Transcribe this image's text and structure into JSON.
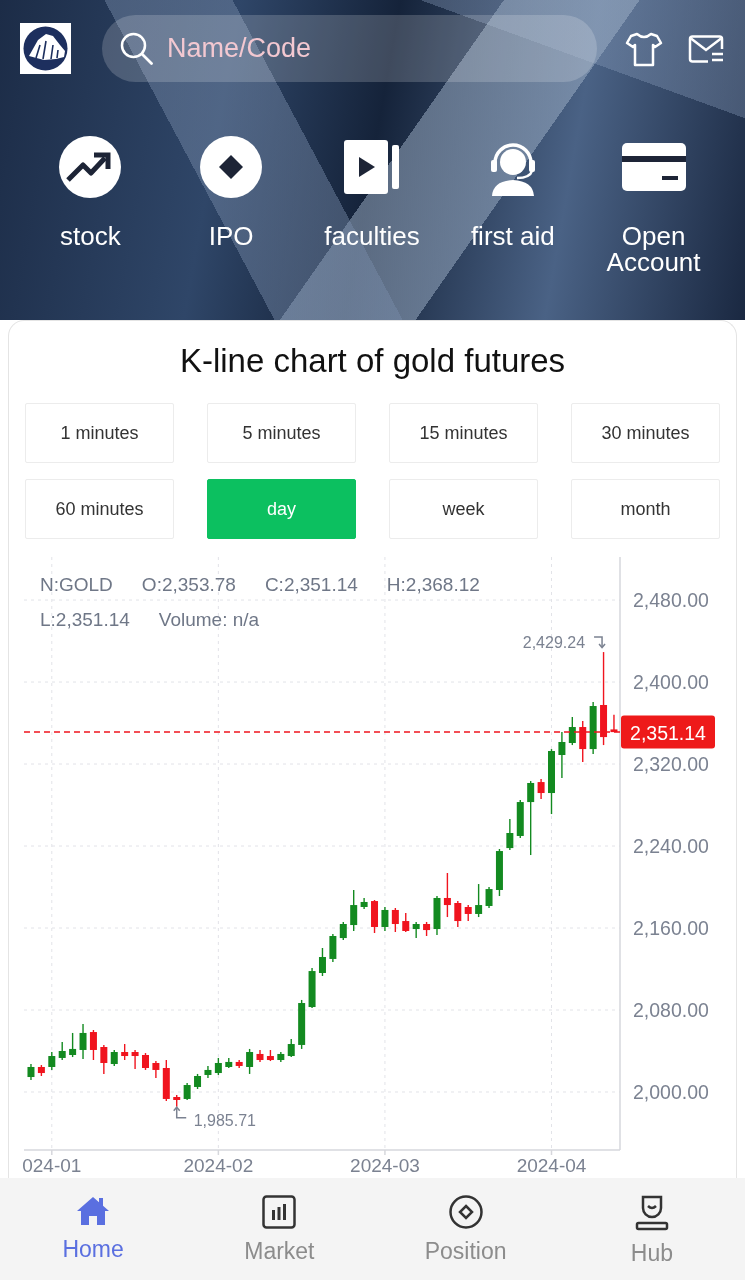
{
  "header": {
    "search": {
      "placeholder": "Name/Code"
    }
  },
  "shortcuts": [
    {
      "label": "stock"
    },
    {
      "label": "IPO"
    },
    {
      "label": "faculties"
    },
    {
      "label": "first aid"
    },
    {
      "label": "Open Account"
    }
  ],
  "chart_card": {
    "title": "K-line chart of gold futures",
    "periods": [
      {
        "label": "1 minutes",
        "selected": false
      },
      {
        "label": "5 minutes",
        "selected": false
      },
      {
        "label": "15 minutes",
        "selected": false
      },
      {
        "label": "30 minutes",
        "selected": false
      },
      {
        "label": "60 minutes",
        "selected": false
      },
      {
        "label": "day",
        "selected": true
      },
      {
        "label": "week",
        "selected": false
      },
      {
        "label": "month",
        "selected": false
      }
    ],
    "legend": [
      [
        "N:GOLD",
        "O:2,353.78",
        "C:2,351.14",
        "H:2,368.12"
      ],
      [
        "L:2,351.14",
        "Volume: n/a"
      ]
    ],
    "chart_data": {
      "type": "candlestick",
      "categories": [
        null,
        null,
        "024-01",
        null,
        null,
        null,
        null,
        null,
        null,
        null,
        null,
        null,
        null,
        null,
        null,
        null,
        null,
        null,
        "2024-02",
        null,
        null,
        null,
        null,
        null,
        null,
        null,
        null,
        null,
        null,
        null,
        null,
        null,
        null,
        null,
        "2024-03",
        null,
        null,
        null,
        null,
        null,
        null,
        null,
        null,
        null,
        null,
        null,
        null,
        null,
        null,
        null,
        "2024-04",
        null,
        null,
        null,
        null,
        null,
        null
      ],
      "ohlc": [
        [
          2014.6,
          2027.3,
          2011.7,
          2024.4
        ],
        [
          2024.4,
          2026.3,
          2015.6,
          2018.5
        ],
        [
          2024.4,
          2039.0,
          2021.5,
          2035.1
        ],
        [
          2033.2,
          2048.8,
          2031.2,
          2040.0
        ],
        [
          2036.1,
          2057.6,
          2034.1,
          2042.0
        ],
        [
          2041.0,
          2066.3,
          2032.2,
          2057.6
        ],
        [
          2058.5,
          2060.5,
          2031.2,
          2041.0
        ],
        [
          2043.9,
          2045.9,
          2017.6,
          2028.3
        ],
        [
          2027.3,
          2041.0,
          2025.4,
          2039.0
        ],
        [
          2039.0,
          2046.8,
          2031.2,
          2035.1
        ],
        [
          2039.0,
          2041.0,
          2022.4,
          2035.1
        ],
        [
          2036.1,
          2038.0,
          2021.5,
          2023.4
        ],
        [
          2028.3,
          2030.2,
          2013.7,
          2021.5
        ],
        [
          2023.4,
          2031.2,
          1991.2,
          1993.2
        ],
        [
          1995.1,
          1997.1,
          1985.71,
          1992.2
        ],
        [
          1993.2,
          2008.8,
          1992.2,
          2006.8
        ],
        [
          2004.9,
          2017.6,
          2002.9,
          2015.6
        ],
        [
          2016.6,
          2025.4,
          2013.7,
          2021.5
        ],
        [
          2018.5,
          2033.2,
          2016.6,
          2028.3
        ],
        [
          2024.4,
          2033.2,
          2023.4,
          2029.3
        ],
        [
          2029.3,
          2031.2,
          2023.4,
          2025.4
        ],
        [
          2024.4,
          2042.0,
          2017.6,
          2039.0
        ],
        [
          2037.1,
          2041.0,
          2029.3,
          2031.2
        ],
        [
          2035.1,
          2041.0,
          2030.2,
          2031.2
        ],
        [
          2031.2,
          2039.0,
          2029.3,
          2037.1
        ],
        [
          2035.1,
          2051.7,
          2034.1,
          2046.8
        ],
        [
          2045.9,
          2089.8,
          2042.0,
          2086.8
        ],
        [
          2082.9,
          2121.0,
          2082.0,
          2118.0
        ],
        [
          2116.1,
          2140.5,
          2113.2,
          2131.7
        ],
        [
          2129.8,
          2154.1,
          2126.8,
          2152.2
        ],
        [
          2150.2,
          2165.9,
          2148.3,
          2163.9
        ],
        [
          2162.9,
          2197.1,
          2157.1,
          2182.4
        ],
        [
          2180.5,
          2189.3,
          2178.5,
          2185.4
        ],
        [
          2186.3,
          2187.3,
          2155.1,
          2161.0
        ],
        [
          2161.0,
          2180.5,
          2157.1,
          2177.6
        ],
        [
          2177.6,
          2179.5,
          2156.1,
          2163.9
        ],
        [
          2166.8,
          2174.6,
          2156.1,
          2157.1
        ],
        [
          2159.0,
          2165.9,
          2150.2,
          2163.9
        ],
        [
          2163.9,
          2165.9,
          2152.2,
          2158.0
        ],
        [
          2159.0,
          2191.2,
          2153.2,
          2189.3
        ],
        [
          2189.3,
          2213.7,
          2170.7,
          2182.4
        ],
        [
          2184.4,
          2186.3,
          2161.0,
          2166.8
        ],
        [
          2180.5,
          2182.4,
          2166.8,
          2173.7
        ],
        [
          2173.7,
          2202.9,
          2170.7,
          2182.4
        ],
        [
          2181.5,
          2200.0,
          2179.5,
          2198.0
        ],
        [
          2197.1,
          2237.1,
          2191.2,
          2235.1
        ],
        [
          2238.0,
          2266.3,
          2236.1,
          2252.7
        ],
        [
          2249.8,
          2284.9,
          2247.8,
          2282.9
        ],
        [
          2282.9,
          2303.4,
          2231.2,
          2301.5
        ],
        [
          2302.4,
          2305.4,
          2285.9,
          2291.7
        ],
        [
          2291.7,
          2334.6,
          2271.2,
          2332.7
        ],
        [
          2328.8,
          2351.2,
          2306.3,
          2341.5
        ],
        [
          2340.5,
          2365.9,
          2338.5,
          2356.1
        ],
        [
          2356.1,
          2361.9,
          2322.0,
          2334.6
        ],
        [
          2334.6,
          2380.5,
          2329.8,
          2376.6
        ],
        [
          2377.6,
          2429.24,
          2338.5,
          2346.3
        ],
        [
          2353.78,
          2368.12,
          2351.14,
          2351.14
        ]
      ],
      "ylim": [
        1943.4,
        2522.0
      ],
      "yticks": [
        {
          "value": 2480,
          "label": "2,480.00"
        },
        {
          "value": 2400,
          "label": "2,400.00"
        },
        {
          "value": 2320,
          "label": "2,320.00"
        },
        {
          "value": 2240,
          "label": "2,240.00"
        },
        {
          "value": 2160,
          "label": "2,160.00"
        },
        {
          "value": 2080,
          "label": "2,080.00"
        },
        {
          "value": 2000,
          "label": "2,000.00"
        }
      ],
      "grid": true,
      "ref_lines": [
        {
          "axis": "y",
          "value": 2351.14,
          "label": "2,351.14"
        }
      ],
      "annotations": [
        "2,429.24",
        "1,985.71"
      ]
    }
  },
  "tab_bar": [
    {
      "label": "Home",
      "selected": true
    },
    {
      "label": "Market",
      "selected": false
    },
    {
      "label": "Position",
      "selected": false
    },
    {
      "label": "Hub",
      "selected": false
    }
  ]
}
